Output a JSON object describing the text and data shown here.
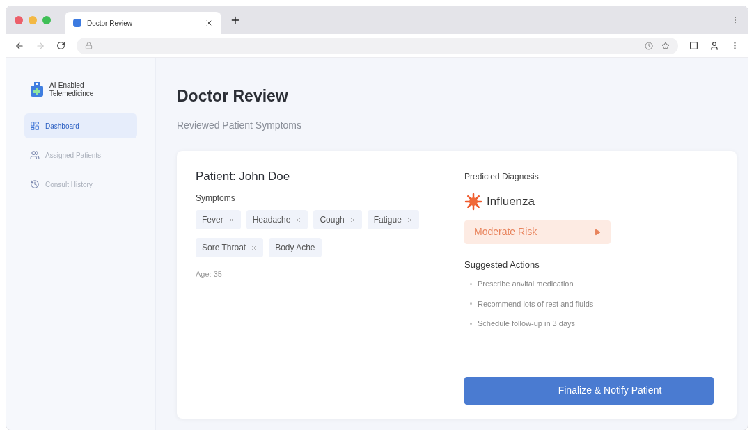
{
  "browser": {
    "tab_title": "Doctor Review"
  },
  "sidebar": {
    "brand": "AI-Enabled Telemedicince",
    "items": [
      {
        "label": "Dashboard",
        "selected": true,
        "kind": "dashboard"
      },
      {
        "label": "Assigned Patients",
        "selected": false,
        "kind": "patients"
      },
      {
        "label": "Consult History",
        "selected": false,
        "kind": "history"
      }
    ]
  },
  "page": {
    "title": "Doctor Review",
    "subtitle": "Reviewed Patient Symptoms"
  },
  "patient": {
    "heading": "Patient: John Doe",
    "symptoms_label": "Symptoms",
    "symptoms": [
      {
        "label": "Fever",
        "removable": true
      },
      {
        "label": "Headache",
        "removable": true
      },
      {
        "label": "Cough",
        "removable": true
      },
      {
        "label": "Fatigue",
        "removable": true
      },
      {
        "label": "Sore Throat",
        "removable": true
      },
      {
        "label": "Body Ache",
        "removable": false
      }
    ],
    "age": "Age: 35"
  },
  "diagnosis": {
    "label": "Predicted Diagnosis",
    "name": "Influenza",
    "risk": {
      "label": "Moderate Risk",
      "kind": "moderate"
    },
    "actions_label": "Suggested Actions",
    "actions": [
      "Prescribe anvital medication",
      "Recommend lots of rest and fluids",
      "Schedule follow-up in 3 days"
    ],
    "button": "Finalize & Notify Patient"
  }
}
